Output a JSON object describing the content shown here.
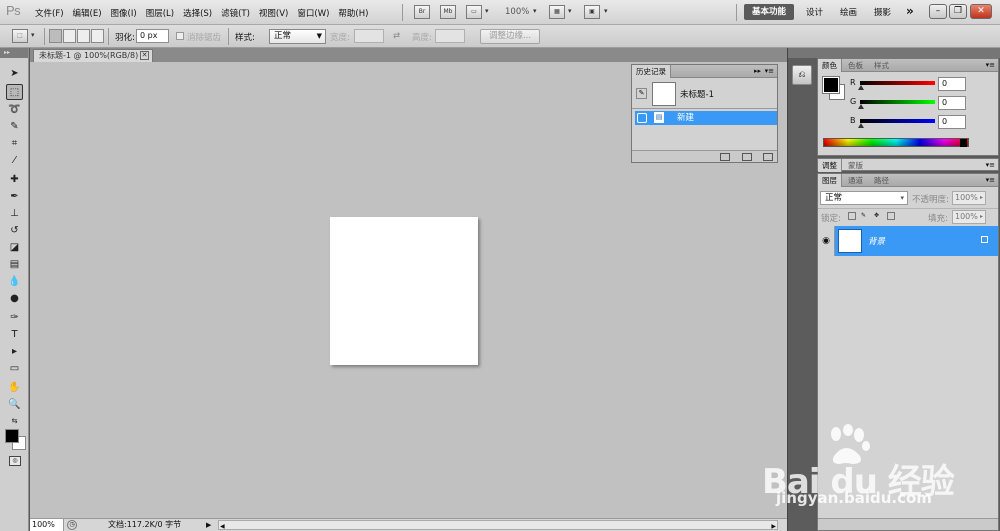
{
  "app": {
    "logo": "Ps"
  },
  "menu": {
    "items": [
      "文件(F)",
      "编辑(E)",
      "图像(I)",
      "图层(L)",
      "选择(S)",
      "滤镜(T)",
      "视图(V)",
      "窗口(W)",
      "帮助(H)"
    ]
  },
  "appbar": {
    "bridge_label": "Br",
    "minibridge_label": "Mb",
    "zoom": "100%"
  },
  "workspace": {
    "essentials": "基本功能",
    "design": "设计",
    "painting": "绘画",
    "photography": "摄影",
    "more": "»"
  },
  "window_controls": {
    "minimize": "–",
    "restore": "❐",
    "close": "✕"
  },
  "options_bar": {
    "feather_label": "羽化:",
    "feather_value": "0 px",
    "antialias_label": "消除锯齿",
    "style_label": "样式:",
    "style_value": "正常",
    "width_label": "宽度:",
    "height_label": "高度:",
    "refine_edge": "调整边缘..."
  },
  "document": {
    "tab_title": "未标题-1 @ 100%(RGB/8)",
    "tab_close": "✕",
    "status_zoom": "100%",
    "status_doc": "文档:117.2K/0 字节"
  },
  "history_panel": {
    "tab": "历史记录",
    "snapshot_name": "未标题-1",
    "state_label": "新建"
  },
  "color_panel": {
    "tabs": [
      "颜色",
      "色板",
      "样式"
    ],
    "channels": [
      {
        "letter": "R",
        "value": "0",
        "gradient": [
          "#000000",
          "#ff0000"
        ]
      },
      {
        "letter": "G",
        "value": "0",
        "gradient": [
          "#000000",
          "#00ff00"
        ]
      },
      {
        "letter": "B",
        "value": "0",
        "gradient": [
          "#000000",
          "#0000ff"
        ]
      }
    ],
    "foreground": "#000000",
    "background": "#ffffff"
  },
  "adjust_strip": {
    "tabs": [
      "调整",
      "蒙版"
    ]
  },
  "layers_panel": {
    "tabs": [
      "图层",
      "通道",
      "路径"
    ],
    "blend_mode": "正常",
    "opacity_label": "不透明度:",
    "opacity_value": "100%",
    "lock_label": "锁定:",
    "fill_label": "填充:",
    "fill_value": "100%",
    "layer_name": "背景"
  },
  "watermark": {
    "brand": "Bai du 经验",
    "url": "jingyan.baidu.com"
  },
  "colors": {
    "selection_blue": "#3999f4",
    "canvas_bg": "#c1c1c1"
  }
}
